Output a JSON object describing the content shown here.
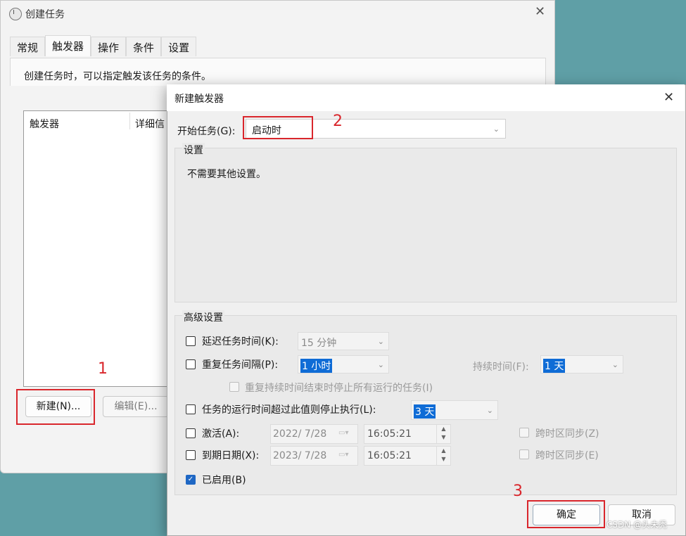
{
  "back_window": {
    "title": "创建任务",
    "tabs": [
      "常规",
      "触发器",
      "操作",
      "条件",
      "设置"
    ],
    "description": "创建任务时，可以指定触发该任务的条件。",
    "list_columns": [
      "触发器",
      "详细信"
    ],
    "new_button": "新建(N)...",
    "edit_button": "编辑(E)..."
  },
  "dialog": {
    "title": "新建触发器",
    "begin_label": "开始任务(G):",
    "begin_value": "启动时",
    "settings_group": "设置",
    "settings_text": "不需要其他设置。",
    "advanced_group": "高级设置",
    "delay_label": "延迟任务时间(K):",
    "delay_value": "15 分钟",
    "repeat_label": "重复任务间隔(P):",
    "repeat_value": "1 小时",
    "duration_label": "持续时间(F):",
    "duration_value": "1 天",
    "stop_at_end_label": "重复持续时间结束时停止所有运行的任务(I)",
    "stop_if_longer_label": "任务的运行时间超过此值则停止执行(L):",
    "stop_if_longer_value": "3 天",
    "activate_label": "激活(A):",
    "activate_date": "2022/ 7/28",
    "activate_time": "16:05:21",
    "sync_tz_label_1": "跨时区同步(Z)",
    "expire_label": "到期日期(X):",
    "expire_date": "2023/ 7/28",
    "expire_time": "16:05:21",
    "sync_tz_label_2": "跨时区同步(E)",
    "enabled_label": "已启用(B)",
    "ok_button": "确定",
    "cancel_button": "取消"
  },
  "annotations": {
    "step1": "1",
    "step2": "2",
    "step3": "3"
  },
  "watermark": "CSDN @头未秃"
}
